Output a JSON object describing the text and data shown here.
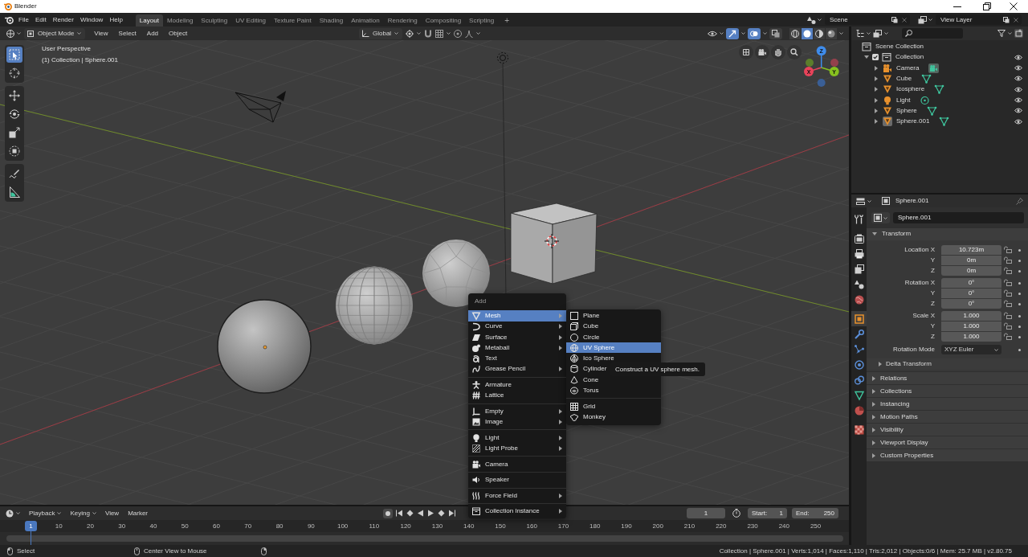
{
  "window": {
    "title": "Blender"
  },
  "topbar": {
    "menus": [
      "File",
      "Edit",
      "Render",
      "Window",
      "Help"
    ],
    "workspaces": [
      {
        "label": "Layout",
        "selected": true
      },
      {
        "label": "Modeling",
        "selected": false
      },
      {
        "label": "Sculpting",
        "selected": false
      },
      {
        "label": "UV Editing",
        "selected": false
      },
      {
        "label": "Texture Paint",
        "selected": false
      },
      {
        "label": "Shading",
        "selected": false
      },
      {
        "label": "Animation",
        "selected": false
      },
      {
        "label": "Rendering",
        "selected": false
      },
      {
        "label": "Compositing",
        "selected": false
      },
      {
        "label": "Scripting",
        "selected": false
      }
    ],
    "add_workspace": "+",
    "scene": "Scene",
    "view_layer": "View Layer"
  },
  "viewport": {
    "header": {
      "mode": "Object Mode",
      "menus": [
        "View",
        "Select",
        "Add",
        "Object"
      ],
      "orientation": "Global",
      "toggles": [
        {
          "on": true
        },
        {
          "on": true
        },
        {
          "on": false
        }
      ],
      "shading": [
        {
          "selected": false
        },
        {
          "selected": true
        },
        {
          "selected": false
        },
        {
          "selected": false
        }
      ]
    },
    "info": [
      "User Perspective",
      "(1) Collection | Sphere.001"
    ],
    "tool_groups": [
      [
        {
          "selected": true
        },
        {
          "selected": false
        }
      ],
      [
        {
          "selected": false
        },
        {
          "selected": false
        },
        {
          "selected": false
        },
        {
          "selected": false
        }
      ],
      [
        {
          "selected": false
        },
        {
          "selected": false
        }
      ]
    ],
    "gizmo_axes": [
      "X",
      "Y",
      "Z"
    ],
    "add_menu": {
      "title": "Add",
      "groups": [
        [
          {
            "label": "Mesh",
            "submenu": true,
            "selected": true
          },
          {
            "label": "Curve",
            "submenu": true,
            "selected": false
          },
          {
            "label": "Surface",
            "submenu": true,
            "selected": false
          },
          {
            "label": "Metaball",
            "submenu": true,
            "selected": false
          },
          {
            "label": "Text",
            "submenu": false,
            "selected": false
          },
          {
            "label": "Grease Pencil",
            "submenu": true,
            "selected": false
          }
        ],
        [
          {
            "label": "Armature",
            "submenu": false,
            "selected": false
          },
          {
            "label": "Lattice",
            "submenu": false,
            "selected": false
          }
        ],
        [
          {
            "label": "Empty",
            "submenu": true,
            "selected": false
          },
          {
            "label": "Image",
            "submenu": true,
            "selected": false
          }
        ],
        [
          {
            "label": "Light",
            "submenu": true,
            "selected": false
          },
          {
            "label": "Light Probe",
            "submenu": true,
            "selected": false
          }
        ],
        [
          {
            "label": "Camera",
            "submenu": false,
            "selected": false
          }
        ],
        [
          {
            "label": "Speaker",
            "submenu": false,
            "selected": false
          }
        ],
        [
          {
            "label": "Force Field",
            "submenu": true,
            "selected": false
          }
        ],
        [
          {
            "label": "Collection Instance",
            "submenu": true,
            "selected": false
          }
        ]
      ]
    },
    "mesh_menu": {
      "groups": [
        [
          {
            "label": "Plane",
            "selected": false
          },
          {
            "label": "Cube",
            "selected": false
          },
          {
            "label": "Circle",
            "selected": false
          },
          {
            "label": "UV Sphere",
            "selected": true
          },
          {
            "label": "Ico Sphere",
            "selected": false
          },
          {
            "label": "Cylinder",
            "selected": false
          },
          {
            "label": "Cone",
            "selected": false
          },
          {
            "label": "Torus",
            "selected": false
          }
        ],
        [
          {
            "label": "Grid",
            "selected": false
          },
          {
            "label": "Monkey",
            "selected": false
          }
        ]
      ]
    },
    "tooltip": "Construct a UV sphere mesh."
  },
  "outliner": {
    "tree": [
      {
        "label": "Scene Collection",
        "kind": "scene",
        "children": [
          {
            "label": "Collection",
            "kind": "collection",
            "expanded": true,
            "checked": true,
            "visible": true,
            "children": [
              {
                "label": "Camera",
                "kind": "camera",
                "expanded": false,
                "selected": false,
                "data_active": true,
                "visible": true
              },
              {
                "label": "Cube",
                "kind": "mesh",
                "expanded": false,
                "selected": false,
                "data_active": false,
                "visible": true
              },
              {
                "label": "Icosphere",
                "kind": "mesh",
                "expanded": false,
                "selected": false,
                "data_active": false,
                "visible": true
              },
              {
                "label": "Light",
                "kind": "light",
                "expanded": false,
                "selected": false,
                "data_active": false,
                "visible": true
              },
              {
                "label": "Sphere",
                "kind": "mesh",
                "expanded": false,
                "selected": false,
                "data_active": false,
                "visible": true
              },
              {
                "label": "Sphere.001",
                "kind": "mesh",
                "expanded": false,
                "selected": true,
                "data_active": false,
                "visible": true
              }
            ]
          }
        ]
      }
    ]
  },
  "properties": {
    "object": "Sphere.001",
    "tabs": [
      [
        {
          "selected": false
        }
      ],
      [
        {
          "selected": false
        },
        {
          "selected": false
        },
        {
          "selected": false
        },
        {
          "selected": false
        },
        {
          "selected": false
        }
      ],
      [
        {
          "selected": true
        },
        {
          "selected": false
        },
        {
          "selected": false
        },
        {
          "selected": false
        },
        {
          "selected": false
        },
        {
          "selected": false
        },
        {
          "selected": false
        }
      ],
      [
        {
          "selected": false
        }
      ]
    ],
    "name": "Sphere.001",
    "panels": [
      {
        "title": "Transform",
        "expanded": true,
        "groups": [
          [
            {
              "label": "Location X",
              "value": "10.723m",
              "kind": "number"
            },
            {
              "label": "Y",
              "value": "0m",
              "kind": "number"
            },
            {
              "label": "Z",
              "value": "0m",
              "kind": "number"
            }
          ],
          [
            {
              "label": "Rotation X",
              "value": "0°",
              "kind": "number"
            },
            {
              "label": "Y",
              "value": "0°",
              "kind": "number"
            },
            {
              "label": "Z",
              "value": "0°",
              "kind": "number"
            }
          ],
          [
            {
              "label": "Scale X",
              "value": "1.000",
              "kind": "number"
            },
            {
              "label": "Y",
              "value": "1.000",
              "kind": "number"
            },
            {
              "label": "Z",
              "value": "1.000",
              "kind": "number"
            }
          ],
          [
            {
              "label": "Rotation Mode",
              "value": "XYZ Euler",
              "kind": "dropdown"
            }
          ]
        ],
        "subpanels": [
          {
            "title": "Delta Transform",
            "expanded": false
          }
        ]
      },
      {
        "title": "Relations",
        "expanded": false
      },
      {
        "title": "Collections",
        "expanded": false
      },
      {
        "title": "Instancing",
        "expanded": false
      },
      {
        "title": "Motion Paths",
        "expanded": false
      },
      {
        "title": "Visibility",
        "expanded": false
      },
      {
        "title": "Viewport Display",
        "expanded": false
      },
      {
        "title": "Custom Properties",
        "expanded": false
      }
    ]
  },
  "timeline": {
    "menus": [
      {
        "label": "Playback",
        "dropdown": true
      },
      {
        "label": "Keying",
        "dropdown": true
      },
      {
        "label": "View",
        "dropdown": false
      },
      {
        "label": "Marker",
        "dropdown": false
      }
    ],
    "current_frame": "1",
    "start_label": "Start:",
    "start": "1",
    "end_label": "End:",
    "end": "250",
    "playhead": "1",
    "ruler": [
      "10",
      "20",
      "30",
      "40",
      "50",
      "60",
      "70",
      "80",
      "90",
      "100",
      "110",
      "120",
      "130",
      "140",
      "150",
      "160",
      "170",
      "180",
      "190",
      "200",
      "210",
      "220",
      "230",
      "240",
      "250"
    ]
  },
  "status_bar": {
    "hints": [
      {
        "text": "Select"
      },
      {
        "text": "Center View to Mouse"
      }
    ],
    "stats": "Collection | Sphere.001 | Verts:1,014 | Faces:1,110 | Tris:2,012 | Objects:0/6 | Mem: 25.7 MB | v2.80.75"
  }
}
